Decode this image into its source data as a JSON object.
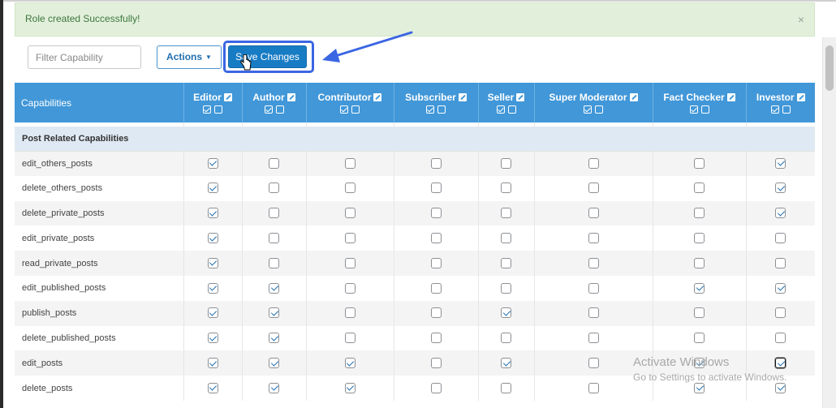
{
  "notice": {
    "text": "Role created Successfully!",
    "close_glyph": "×"
  },
  "toolbar": {
    "filter_placeholder": "Filter Capability",
    "actions_label": "Actions",
    "actions_caret": "▼",
    "save_label": "Save Changes"
  },
  "table": {
    "capabilities_header": "Capabilities",
    "roles": [
      "Editor",
      "Author",
      "Contributor",
      "Subscriber",
      "Seller",
      "Super Moderator",
      "Fact Checker",
      "Investor"
    ],
    "section_title": "Post Related Capabilities",
    "rows": [
      {
        "name": "edit_others_posts",
        "values": [
          true,
          false,
          false,
          false,
          false,
          false,
          false,
          true
        ]
      },
      {
        "name": "delete_others_posts",
        "values": [
          true,
          false,
          false,
          false,
          false,
          false,
          false,
          true
        ]
      },
      {
        "name": "delete_private_posts",
        "values": [
          true,
          false,
          false,
          false,
          false,
          false,
          false,
          true
        ]
      },
      {
        "name": "edit_private_posts",
        "values": [
          true,
          false,
          false,
          false,
          false,
          false,
          false,
          false
        ]
      },
      {
        "name": "read_private_posts",
        "values": [
          true,
          false,
          false,
          false,
          false,
          false,
          false,
          false
        ]
      },
      {
        "name": "edit_published_posts",
        "values": [
          true,
          true,
          false,
          false,
          false,
          false,
          true,
          true
        ]
      },
      {
        "name": "publish_posts",
        "values": [
          true,
          true,
          false,
          false,
          true,
          false,
          false,
          false
        ]
      },
      {
        "name": "delete_published_posts",
        "values": [
          true,
          true,
          false,
          false,
          false,
          false,
          false,
          false
        ]
      },
      {
        "name": "edit_posts",
        "values": [
          true,
          true,
          true,
          false,
          true,
          false,
          true,
          false
        ]
      },
      {
        "name": "delete_posts",
        "values": [
          true,
          true,
          true,
          false,
          false,
          false,
          true,
          true
        ]
      }
    ]
  },
  "watermark": {
    "line1": "Activate Windows",
    "line2": "Go to Settings to activate Windows."
  },
  "colors": {
    "header_bg": "#4197d8",
    "primary_button": "#187cc4",
    "highlight": "#3b66e3",
    "notice_bg": "#e2f0db"
  },
  "icons": {
    "edit": "edit-icon",
    "cursor": "hand-pointer-icon",
    "arrow": "annotation-arrow-icon"
  }
}
